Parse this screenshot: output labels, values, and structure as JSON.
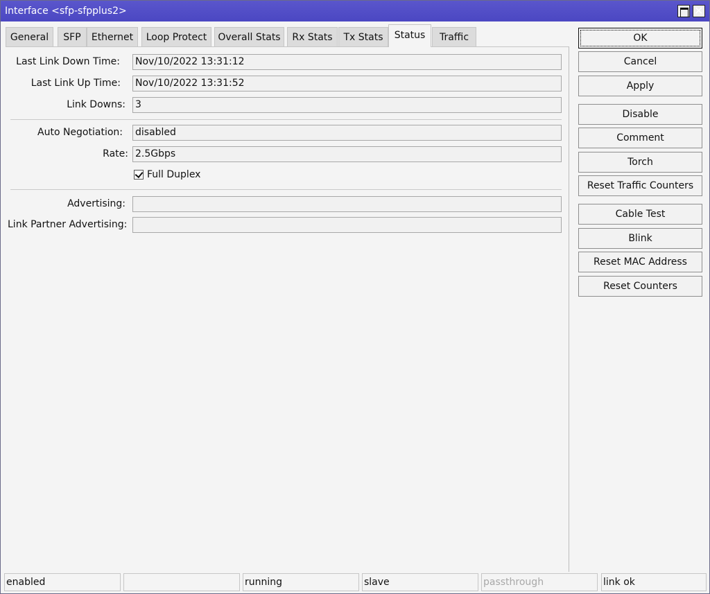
{
  "window": {
    "title": "Interface <sfp-sfpplus2>",
    "title_bg": "#4b47c2"
  },
  "tabs": [
    {
      "label": "General"
    },
    {
      "label": "SFP"
    },
    {
      "label": "Ethernet"
    },
    {
      "label": "Loop Protect"
    },
    {
      "label": "Overall Stats"
    },
    {
      "label": "Rx Stats"
    },
    {
      "label": "Tx Stats"
    },
    {
      "label": "Status",
      "active": true
    },
    {
      "label": "Traffic"
    }
  ],
  "fields": {
    "last_link_down_time": {
      "label": "Last Link Down Time:",
      "value": "Nov/10/2022 13:31:12"
    },
    "last_link_up_time": {
      "label": "Last Link Up Time:",
      "value": "Nov/10/2022 13:31:52"
    },
    "link_downs": {
      "label": "Link Downs:",
      "value": "3"
    },
    "auto_negotiation": {
      "label": "Auto Negotiation:",
      "value": "disabled"
    },
    "rate": {
      "label": "Rate:",
      "value": "2.5Gbps"
    },
    "full_duplex": {
      "label": "Full Duplex",
      "checked": true
    },
    "advertising": {
      "label": "Advertising:",
      "value": ""
    },
    "link_partner_advertising": {
      "label": "Link Partner Advertising:",
      "value": ""
    }
  },
  "buttons": {
    "ok": "OK",
    "cancel": "Cancel",
    "apply": "Apply",
    "disable": "Disable",
    "comment": "Comment",
    "torch": "Torch",
    "reset_traffic_counters": "Reset Traffic Counters",
    "cable_test": "Cable Test",
    "blink": "Blink",
    "reset_mac_address": "Reset MAC Address",
    "reset_counters": "Reset Counters"
  },
  "statusbar": [
    {
      "text": "enabled"
    },
    {
      "text": ""
    },
    {
      "text": "running"
    },
    {
      "text": "slave"
    },
    {
      "text": "passthrough",
      "dim": true
    },
    {
      "text": "link ok"
    }
  ],
  "icons": {
    "maximize": "maximize-icon",
    "close": "close-icon",
    "checkbox": "checkmark-icon"
  }
}
